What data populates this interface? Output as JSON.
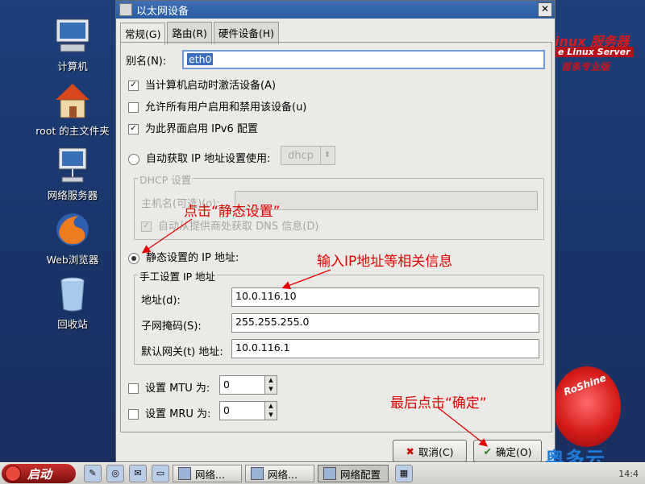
{
  "desktop": {
    "icons": [
      {
        "label": "计算机",
        "icon": "computer-icon"
      },
      {
        "label": "root 的主文件夹",
        "icon": "home-folder-icon"
      },
      {
        "label": "网络服务器",
        "icon": "network-server-icon"
      },
      {
        "label": "Web浏览器",
        "icon": "firefox-icon"
      },
      {
        "label": "回收站",
        "icon": "trash-icon"
      }
    ],
    "brand_text_1": "inux 服务器",
    "brand_text_2": "e Linux Server",
    "brand_text_3": "首条专业版",
    "emblem_text": "RoShine",
    "watermark": "奥多云"
  },
  "dialog": {
    "title": "以太网设备",
    "tabs": [
      {
        "label": "常规(G)",
        "active": true
      },
      {
        "label": "路由(R)",
        "active": false
      },
      {
        "label": "硬件设备(H)",
        "active": false
      }
    ],
    "alias_label": "别名(N):",
    "alias_value": "eth0",
    "checks": [
      {
        "label": "当计算机启动时激活设备(A)",
        "checked": true
      },
      {
        "label": "允许所有用户启用和禁用该设备(u)",
        "checked": false
      },
      {
        "label": "为此界面启用 IPv6 配置",
        "checked": true
      }
    ],
    "auto_ip_label": "自动获取 IP 地址设置使用:",
    "auto_ip_method": "dhcp",
    "dhcp_group_title": "DHCP 设置",
    "hostname_label": "主机名(可选)(o):",
    "auto_dns_label": "自动从提供商处获取 DNS 信息(D)",
    "static_label": "静态设置的 IP 地址:",
    "manual_group_title": "手工设置 IP 地址",
    "address_label": "地址(d):",
    "address_value": "10.0.116.10",
    "netmask_label": "子网掩码(S):",
    "netmask_value": "255.255.255.0",
    "gateway_label": "默认网关(t) 地址:",
    "gateway_value": "10.0.116.1",
    "mtu_label": "设置 MTU 为:",
    "mtu_value": "0",
    "mru_label": "设置 MRU 为:",
    "mru_value": "0",
    "cancel_label": "取消(C)",
    "ok_label": "确定(O)"
  },
  "annotations": {
    "click_static": "点击“静态设置”",
    "enter_ip": "输入IP地址等相关信息",
    "finally_ok": "最后点击“确定”",
    "color": "#e00000"
  },
  "taskbar": {
    "start_label": "启动",
    "tasks": [
      {
        "label": "网络...",
        "active": false
      },
      {
        "label": "网络...",
        "active": false
      },
      {
        "label": "网络配置",
        "active": true
      }
    ],
    "clock": "14:4"
  }
}
